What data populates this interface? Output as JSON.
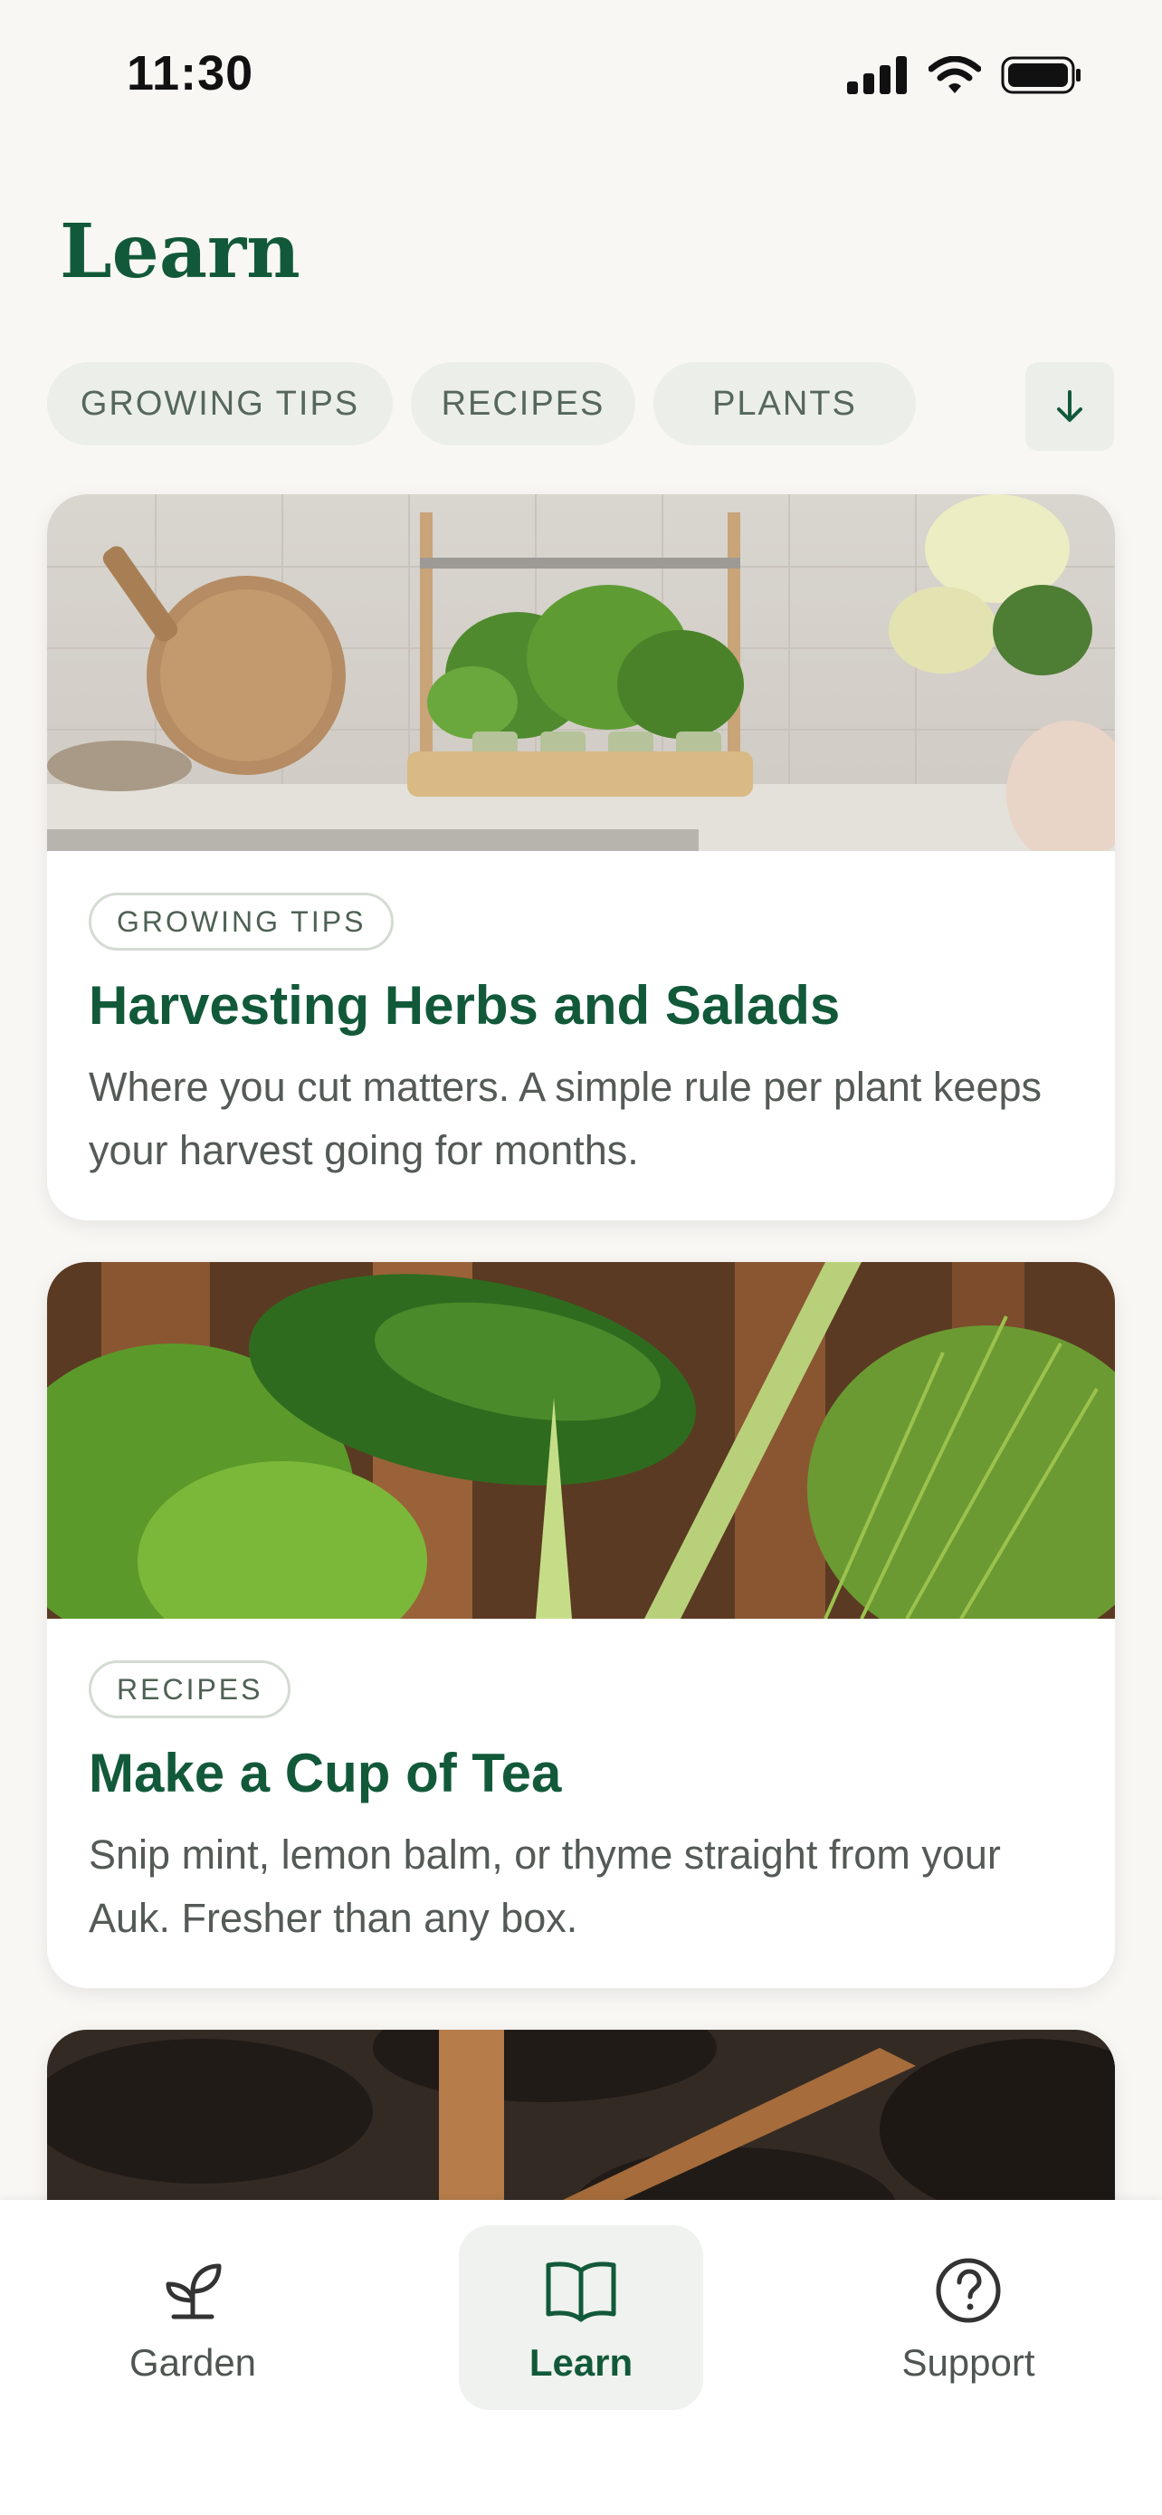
{
  "status_bar": {
    "time": "11:30"
  },
  "page": {
    "title": "Learn"
  },
  "filters": {
    "chips": [
      "GROWING TIPS",
      "RECIPES",
      "PLANTS"
    ],
    "sort_icon": "arrow-down-icon"
  },
  "cards": [
    {
      "tag": "GROWING TIPS",
      "title": "Harvesting Herbs and Salads",
      "description": "Where you cut matters. A simple rule per plant keeps your harvest going for months."
    },
    {
      "tag": "RECIPES",
      "title": "Make a Cup of Tea",
      "description": "Snip mint, lemon balm, or thyme straight from your Auk. Fresher than any box."
    }
  ],
  "tab_bar": {
    "items": [
      {
        "label": "Garden",
        "icon": "sprout-icon"
      },
      {
        "label": "Learn",
        "icon": "book-icon",
        "active": true
      },
      {
        "label": "Support",
        "icon": "help-circle-icon"
      }
    ]
  },
  "colors": {
    "brand_green": "#12593a",
    "chip_background": "#ebeee9",
    "page_background": "#f8f7f4"
  }
}
